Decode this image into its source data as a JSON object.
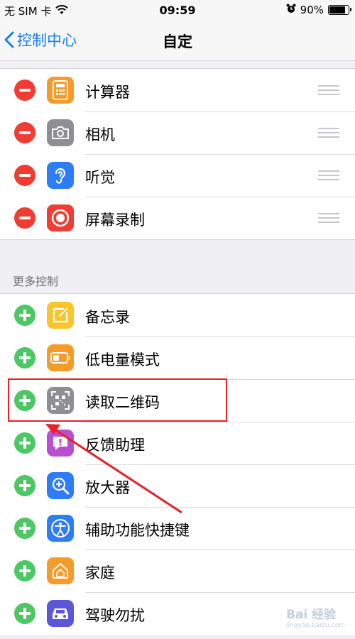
{
  "status_bar": {
    "carrier": "无 SIM 卡",
    "time": "09:59",
    "battery": "90%",
    "battery_level": 0.9
  },
  "nav": {
    "back_label": "控制中心",
    "title": "自定"
  },
  "included_controls": [
    {
      "label": "计算器",
      "icon": "calculator-icon",
      "color": "#f49b2a"
    },
    {
      "label": "相机",
      "icon": "camera-icon",
      "color": "#8e8e93"
    },
    {
      "label": "听觉",
      "icon": "ear-icon",
      "color": "#2e7cf6"
    },
    {
      "label": "屏幕录制",
      "icon": "record-icon",
      "color": "#f03c32"
    }
  ],
  "more_controls": {
    "header": "更多控制",
    "items": [
      {
        "label": "备忘录",
        "icon": "notes-icon",
        "color": "#f8c52b"
      },
      {
        "label": "低电量模式",
        "icon": "battery-icon",
        "color": "#f49b2a"
      },
      {
        "label": "读取二维码",
        "icon": "qr-code-icon",
        "color": "#8e8e93"
      },
      {
        "label": "反馈助理",
        "icon": "feedback-icon",
        "color": "#b84fd1"
      },
      {
        "label": "放大器",
        "icon": "magnifier-icon",
        "color": "#2e7cf6"
      },
      {
        "label": "辅助功能快捷键",
        "icon": "accessibility-icon",
        "color": "#2e7cf6"
      },
      {
        "label": "家庭",
        "icon": "home-icon",
        "color": "#f49b2a"
      },
      {
        "label": "驾驶勿扰",
        "icon": "car-icon",
        "color": "#5b57d6"
      }
    ]
  },
  "annotation": {
    "color": "#e8202a"
  },
  "watermark": {
    "brand": "Bai 经验",
    "url": "jingyan.baidu.com"
  }
}
